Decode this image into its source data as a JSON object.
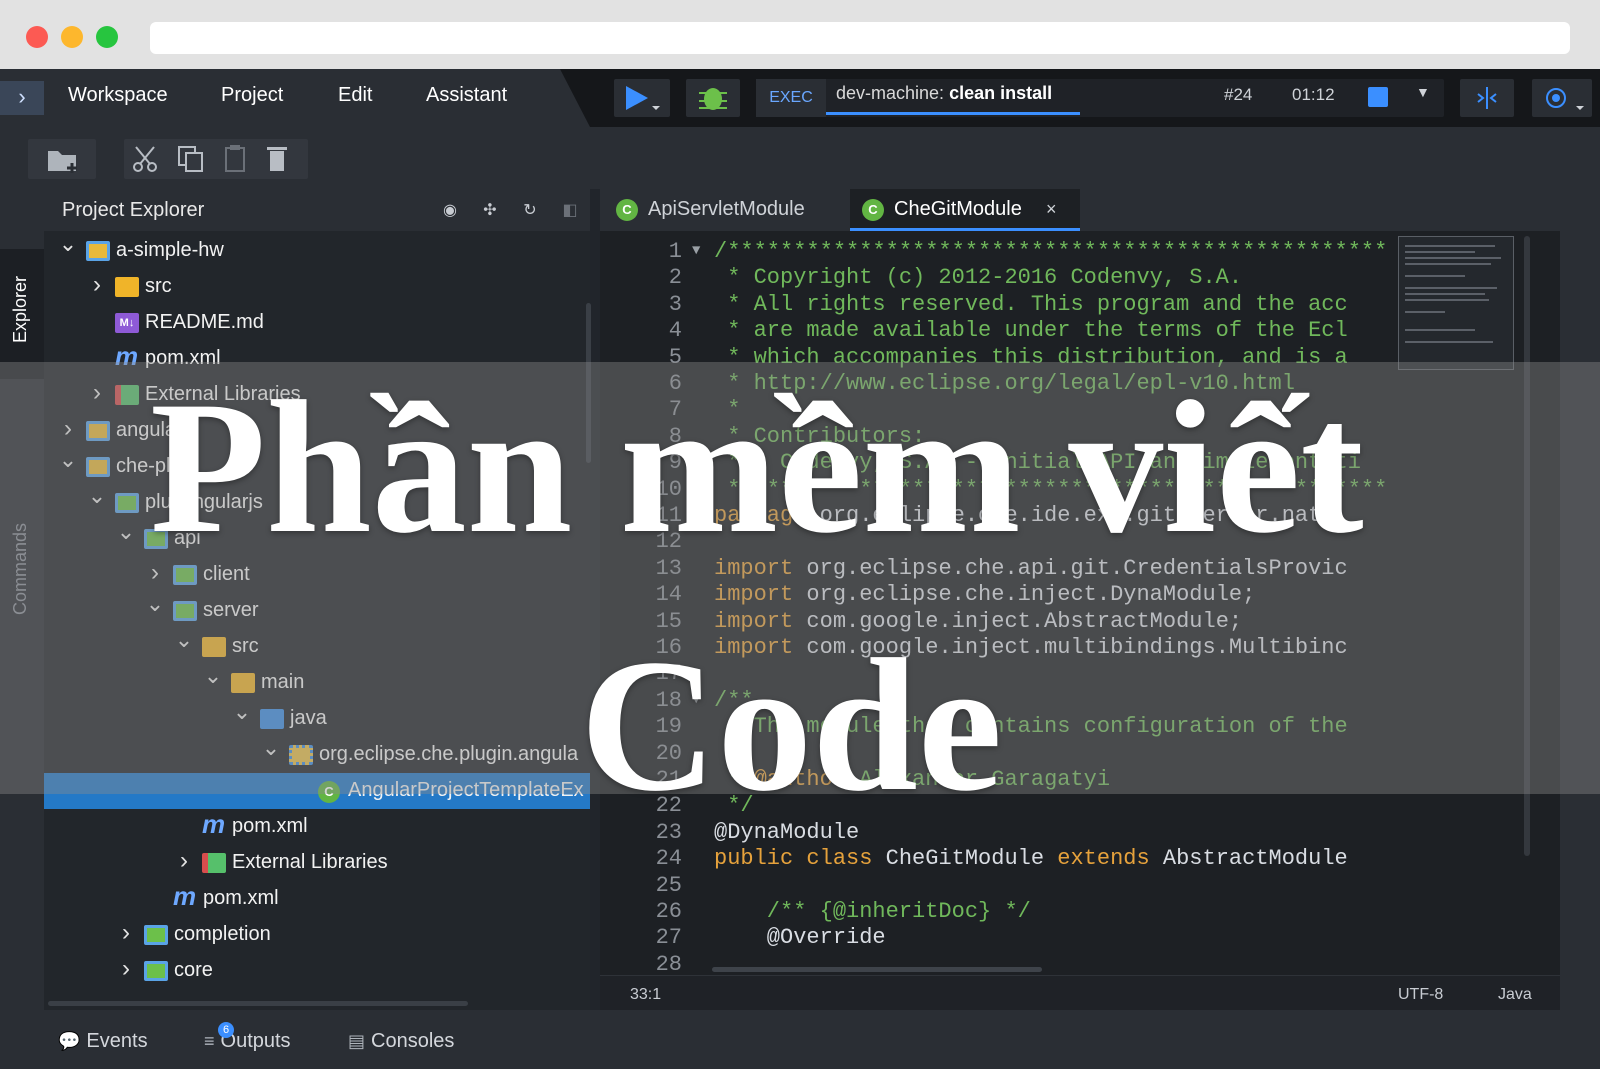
{
  "menubar": {
    "items": [
      "Workspace",
      "Project",
      "Edit",
      "Assistant"
    ],
    "exec": {
      "label": "EXEC",
      "machine": "dev-machine:",
      "command": "clean install",
      "run_number": "#24",
      "elapsed": "01:12"
    }
  },
  "left_strip": {
    "tabs": [
      "Explorer",
      "Commands"
    ]
  },
  "explorer": {
    "title": "Project Explorer",
    "tree": [
      {
        "label": "a-simple-hw",
        "icon": "folder-module-icon",
        "arrow": "expanded"
      },
      {
        "label": "src",
        "icon": "folder-icon",
        "arrow": "collapsed"
      },
      {
        "label": "README.md",
        "icon": "markdown-icon",
        "icon_text": "M↓",
        "arrow": "none"
      },
      {
        "label": "pom.xml",
        "icon": "maven-icon",
        "icon_text": "m",
        "arrow": "none"
      },
      {
        "label": "External Libraries",
        "icon": "library-icon",
        "arrow": "collapsed"
      },
      {
        "label": "angular",
        "icon": "folder-module-icon",
        "arrow": "collapsed"
      },
      {
        "label": "che-plug",
        "icon": "folder-module-icon",
        "arrow": "expanded"
      },
      {
        "label": "plugi ngularjs",
        "icon": "module-icon",
        "arrow": "expanded"
      },
      {
        "label": "api",
        "icon": "module-icon",
        "arrow": "expanded"
      },
      {
        "label": "client",
        "icon": "module-icon",
        "arrow": "collapsed"
      },
      {
        "label": "server",
        "icon": "module-icon",
        "arrow": "expanded"
      },
      {
        "label": "src",
        "icon": "folder-icon",
        "arrow": "expanded"
      },
      {
        "label": "main",
        "icon": "folder-icon",
        "arrow": "expanded"
      },
      {
        "label": "java",
        "icon": "folder-blue-icon",
        "arrow": "expanded"
      },
      {
        "label": "org.eclipse.che.plugin.angula",
        "icon": "package-icon",
        "arrow": "expanded"
      },
      {
        "label": "AngularProjectTemplateEx",
        "icon": "class-icon",
        "icon_text": "C",
        "arrow": "none",
        "selected": true
      },
      {
        "label": "pom.xml",
        "icon": "maven-icon",
        "icon_text": "m",
        "arrow": "none"
      },
      {
        "label": "External Libraries",
        "icon": "library-icon",
        "arrow": "collapsed"
      },
      {
        "label": "pom.xml",
        "icon": "maven-icon",
        "icon_text": "m",
        "arrow": "none"
      },
      {
        "label": "completion",
        "icon": "module-icon",
        "arrow": "collapsed"
      },
      {
        "label": "core",
        "icon": "module-icon",
        "arrow": "collapsed"
      }
    ]
  },
  "editor": {
    "tabs": [
      {
        "label": "ApiServletModule",
        "icon_text": "C",
        "active": false
      },
      {
        "label": "CheGitModule",
        "icon_text": "C",
        "active": true,
        "close": "×"
      }
    ],
    "lines": [
      {
        "n": "1",
        "fold": "▼",
        "parts": [
          {
            "t": "/*******************************************************",
            "c": "comment"
          }
        ]
      },
      {
        "n": "2",
        "parts": [
          {
            "t": " * Copyright (c) 2012-2016 Codenvy, S.A.",
            "c": "comment"
          }
        ]
      },
      {
        "n": "3",
        "parts": [
          {
            "t": " * All rights reserved. This program and the acc",
            "c": "comment"
          }
        ]
      },
      {
        "n": "4",
        "parts": [
          {
            "t": " * are made available under the terms of the Ecl",
            "c": "comment"
          }
        ]
      },
      {
        "n": "5",
        "parts": [
          {
            "t": " * which accompanies this distribution, and is a",
            "c": "comment"
          }
        ]
      },
      {
        "n": "6",
        "parts": [
          {
            "t": " * http://www.eclipse.org/legal/epl-v10.html",
            "c": "comment"
          }
        ]
      },
      {
        "n": "7",
        "parts": [
          {
            "t": " *",
            "c": "comment"
          }
        ]
      },
      {
        "n": "8",
        "parts": [
          {
            "t": " * Contributors:",
            "c": "comment"
          }
        ]
      },
      {
        "n": "9",
        "parts": [
          {
            "t": " *   Codenvy, S.A. - initial API and implementati",
            "c": "comment"
          }
        ]
      },
      {
        "n": "10",
        "parts": [
          {
            "t": " *******************************************************",
            "c": "comment"
          }
        ]
      },
      {
        "n": "11",
        "parts": [
          {
            "t": "package",
            "c": "keyword"
          },
          {
            "t": " org.eclipse.che.ide.ext.git.server.nati",
            "c": "plain"
          }
        ]
      },
      {
        "n": "12",
        "parts": []
      },
      {
        "n": "13",
        "parts": [
          {
            "t": "import",
            "c": "keyword"
          },
          {
            "t": " org.eclipse.che.api.git.CredentialsProvic",
            "c": "plain"
          }
        ]
      },
      {
        "n": "14",
        "parts": [
          {
            "t": "import",
            "c": "keyword"
          },
          {
            "t": " org.eclipse.che.inject.DynaModule;",
            "c": "plain"
          }
        ]
      },
      {
        "n": "15",
        "parts": [
          {
            "t": "import",
            "c": "keyword"
          },
          {
            "t": " com.google.inject.AbstractModule;",
            "c": "plain"
          }
        ]
      },
      {
        "n": "16",
        "parts": [
          {
            "t": "import",
            "c": "keyword"
          },
          {
            "t": " com.google.inject.multibindings.Multibinc",
            "c": "plain"
          }
        ]
      },
      {
        "n": "17",
        "parts": []
      },
      {
        "n": "18",
        "fold": "▼",
        "parts": [
          {
            "t": "/**",
            "c": "comment"
          }
        ]
      },
      {
        "n": "19",
        "parts": [
          {
            "t": " * The module that contains configuration of the",
            "c": "comment"
          }
        ]
      },
      {
        "n": "20",
        "parts": [
          {
            "t": " *",
            "c": "comment"
          }
        ]
      },
      {
        "n": "21",
        "parts": [
          {
            "t": " * ",
            "c": "comment"
          },
          {
            "t": "@author",
            "c": "keyword"
          },
          {
            "t": " Alexander Garagatyi",
            "c": "comment"
          }
        ]
      },
      {
        "n": "22",
        "parts": [
          {
            "t": " */",
            "c": "comment"
          }
        ]
      },
      {
        "n": "23",
        "parts": [
          {
            "t": "@DynaModule",
            "c": "anno"
          }
        ]
      },
      {
        "n": "24",
        "parts": [
          {
            "t": "public class",
            "c": "keyword"
          },
          {
            "t": " CheGitModule ",
            "c": "plain"
          },
          {
            "t": "extends",
            "c": "keyword"
          },
          {
            "t": " AbstractModule",
            "c": "plain"
          }
        ]
      },
      {
        "n": "25",
        "parts": []
      },
      {
        "n": "26",
        "parts": [
          {
            "t": "    /** {@inheritDoc} */",
            "c": "comment"
          }
        ]
      },
      {
        "n": "27",
        "parts": [
          {
            "t": "    @Override",
            "c": "anno"
          }
        ]
      },
      {
        "n": "28",
        "parts": []
      }
    ]
  },
  "status": {
    "position": "33:1",
    "encoding": "UTF-8",
    "language": "Java"
  },
  "bottom_tabs": [
    {
      "label": "Events",
      "icon": "chat-icon"
    },
    {
      "label": "Outputs",
      "icon": "outputs-icon",
      "badge": "6"
    },
    {
      "label": "Consoles",
      "icon": "terminal-icon"
    }
  ],
  "overlay": {
    "line1": "Phần mềm viết",
    "line2": "Code"
  },
  "colors": {
    "accent": "#3b8fff",
    "selection": "#2479c7",
    "comment": "#70b85b",
    "keyword": "#e6a23c",
    "background": "#21252b"
  }
}
